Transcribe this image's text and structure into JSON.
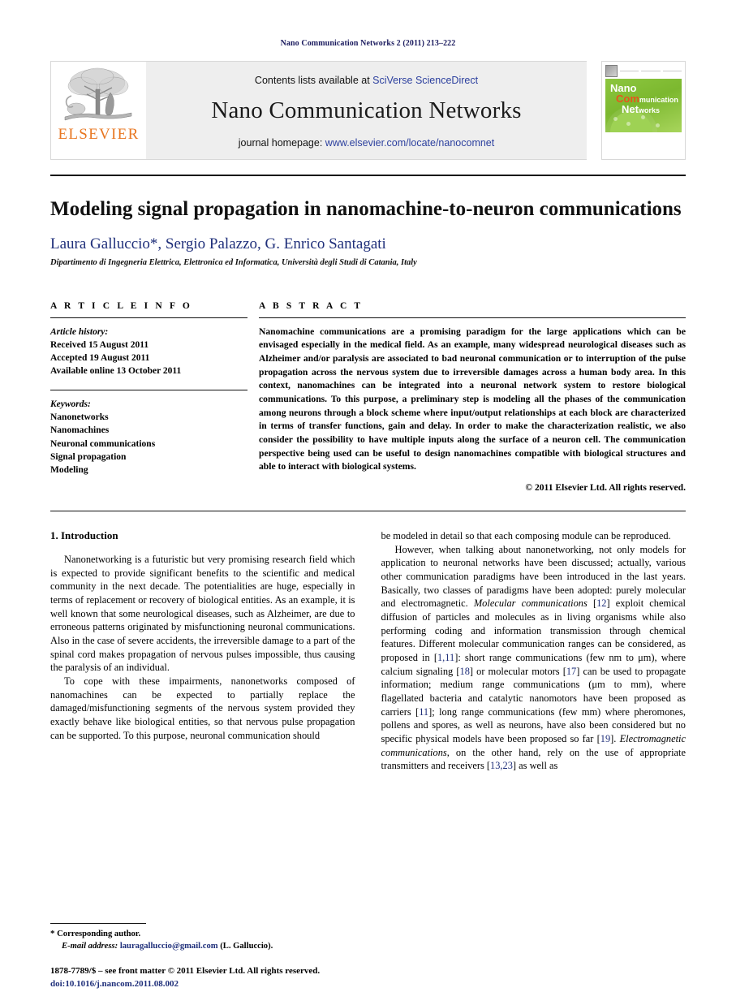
{
  "running_head": "Nano Communication Networks 2 (2011) 213–222",
  "masthead": {
    "publisher_logo_word": "ELSEVIER",
    "contents_prefix": "Contents lists available at ",
    "contents_link": "SciVerse ScienceDirect",
    "journal_title": "Nano Communication Networks",
    "homepage_prefix": "journal homepage: ",
    "homepage_url": "www.elsevier.com/locate/nanocomnet",
    "cover": {
      "line1": "Nano",
      "line2_hi": "Com",
      "line2_lo": "munication",
      "line3_hi": "Net",
      "line3_lo": "works"
    }
  },
  "article": {
    "title": "Modeling signal propagation in nanomachine-to-neuron communications",
    "authors": "Laura Galluccio*, Sergio Palazzo, G. Enrico Santagati",
    "affiliation": "Dipartimento di Ingegneria Elettrica, Elettronica ed Informatica, Università degli Studi di Catania, Italy"
  },
  "info": {
    "heading": "A R T I C L E    I N F O",
    "history_label": "Article history:",
    "history": [
      "Received 15 August 2011",
      "Accepted 19 August 2011",
      "Available online 13 October 2011"
    ],
    "keywords_label": "Keywords:",
    "keywords": [
      "Nanonetworks",
      "Nanomachines",
      "Neuronal communications",
      "Signal propagation",
      "Modeling"
    ]
  },
  "abstract": {
    "heading": "A B S T R A C T",
    "text": "Nanomachine communications are a promising paradigm for the large applications which can be envisaged especially in the medical field. As an example, many widespread neurological diseases such as Alzheimer and/or paralysis are associated to bad neuronal communication or to interruption of the pulse propagation across the nervous system due to irreversible damages across a human body area. In this context, nanomachines can be integrated into a neuronal network system to restore biological communications. To this purpose, a preliminary step is modeling all the phases of the communication among neurons through a block scheme where input/output relationships at each block are characterized in terms of transfer functions, gain and delay. In order to make the characterization realistic, we also consider the possibility to have multiple inputs along the surface of a neuron cell. The communication perspective being used can be useful to design nanomachines compatible with biological structures and able to interact with biological systems.",
    "copyright": "© 2011 Elsevier Ltd. All rights reserved."
  },
  "body": {
    "section_heading": "1. Introduction",
    "left_paragraphs": [
      "Nanonetworking is a futuristic but very promising research field which is expected to provide significant benefits to the scientific and medical community in the next decade. The potentialities are huge, especially in terms of replacement or recovery of biological entities. As an example, it is well known that some neurological diseases, such as Alzheimer, are due to erroneous patterns originated by misfunctioning neuronal communications. Also in the case of severe accidents, the irreversible damage to a part of the spinal cord makes propagation of nervous pulses impossible, thus causing the paralysis of an individual.",
      "To cope with these impairments, nanonetworks composed of nanomachines can be expected to partially replace the damaged/misfunctioning segments of the nervous system provided they exactly behave like biological entities, so that nervous pulse propagation can be supported. To this purpose, neuronal communication should"
    ],
    "right_paragraph_continued": "be modeled in detail so that each composing module can be reproduced.",
    "right_paragraph_2_parts": [
      {
        "t": "However, when talking about nanonetworking, not only models for application to neuronal networks have been discussed; actually, various other communication paradigms have been introduced in the last years. Basically, two classes of paradigms have been adopted: purely molecular and electromagnetic. ",
        "s": "plain"
      },
      {
        "t": "Molecular communications",
        "s": "italic"
      },
      {
        "t": " [",
        "s": "plain"
      },
      {
        "t": "12",
        "s": "cite"
      },
      {
        "t": "] exploit chemical diffusion of particles and molecules as in living organisms while also performing coding and information transmission through chemical features. Different molecular communication ranges can be considered, as proposed in [",
        "s": "plain"
      },
      {
        "t": "1,11",
        "s": "cite"
      },
      {
        "t": "]: short range communications (few nm to μm), where calcium signaling [",
        "s": "plain"
      },
      {
        "t": "18",
        "s": "cite"
      },
      {
        "t": "] or molecular motors [",
        "s": "plain"
      },
      {
        "t": "17",
        "s": "cite"
      },
      {
        "t": "] can be used to propagate information; medium range communications (μm to mm), where flagellated bacteria and catalytic nanomotors have been proposed as carriers [",
        "s": "plain"
      },
      {
        "t": "11",
        "s": "cite"
      },
      {
        "t": "]; long range communications (few mm) where pheromones, pollens and spores, as well as neurons, have also been considered but no specific physical models have been proposed so far [",
        "s": "plain"
      },
      {
        "t": "19",
        "s": "cite"
      },
      {
        "t": "]. ",
        "s": "plain"
      },
      {
        "t": "Electromagnetic communications",
        "s": "italic"
      },
      {
        "t": ", on the other hand, rely on the use of appropriate transmitters and receivers [",
        "s": "plain"
      },
      {
        "t": "13,23",
        "s": "cite"
      },
      {
        "t": "] as well as",
        "s": "plain"
      }
    ]
  },
  "footnote": {
    "corresponding_star": "*",
    "corresponding_text": "Corresponding author.",
    "email_label": "E-mail address:",
    "email": "lauragalluccio@gmail.com",
    "email_owner": "(L. Galluccio).",
    "issn_line": "1878-7789/$ – see front matter © 2011 Elsevier Ltd. All rights reserved.",
    "doi_line": "doi:10.1016/j.nancom.2011.08.002"
  },
  "colors": {
    "link_blue": "#2b3f9e",
    "author_blue": "#1f2f7a",
    "elsevier_orange": "#e87722",
    "cover_green": "#8cc63f"
  }
}
